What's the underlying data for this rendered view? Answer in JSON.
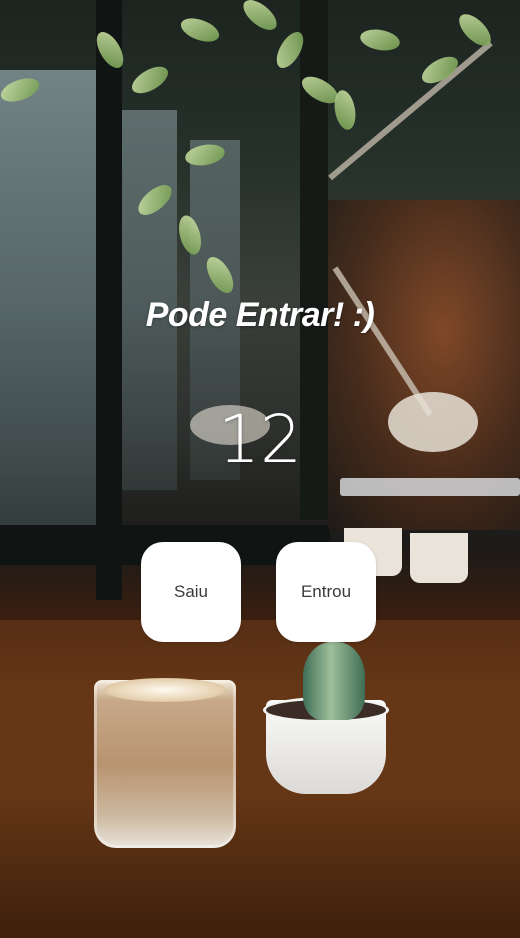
{
  "app": {
    "title": "Pode Entrar! :)",
    "counter": "12"
  },
  "buttons": {
    "left_label": "Saiu",
    "right_label": "Entrou"
  },
  "background": {
    "description_icon": "cafe-photo-background",
    "button_color": "#ffffff",
    "text_color": "#ffffff"
  }
}
